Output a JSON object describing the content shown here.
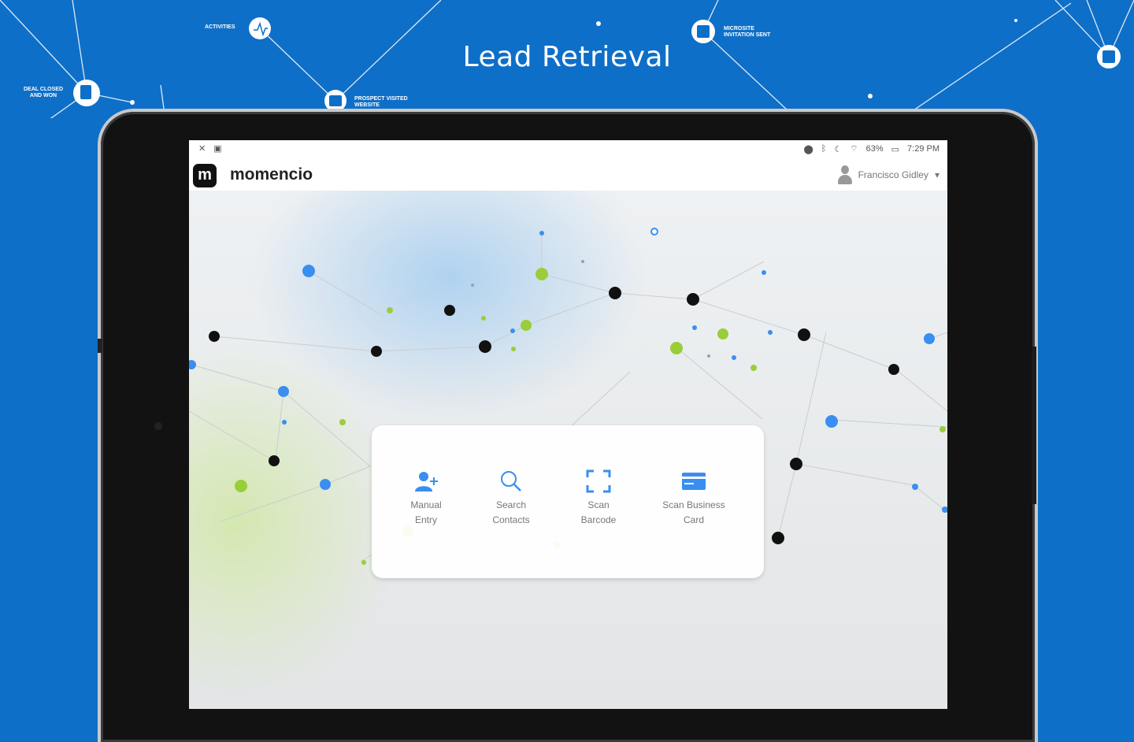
{
  "headline": "Lead Retrieval",
  "colors": {
    "background": "#0e6fc8",
    "accent_blue": "#3a8ef0",
    "accent_green": "#9acd3a",
    "node_dark": "#111111"
  },
  "background_nodes": [
    {
      "label": "ACTIVITIES",
      "icon": "activity-icon"
    },
    {
      "label": "DEAL CLOSED AND WON",
      "icon": "document-icon"
    },
    {
      "label": "PROSPECT VISITED WEBSITE",
      "icon": "web-icon"
    },
    {
      "label": "MICROSITE INVITATION SENT",
      "icon": "calendar-icon"
    },
    {
      "label": "",
      "icon": "calendar-icon"
    }
  ],
  "status_bar": {
    "left_icons": [
      "mute-icon",
      "image-icon"
    ],
    "battery": "63%",
    "time": "7:29 PM"
  },
  "app": {
    "logo_letter": "m",
    "name": "momencio",
    "user_name": "Francisco Gidley",
    "user_menu_caret": "▾"
  },
  "actions": [
    {
      "line1": "Manual",
      "line2": "Entry",
      "icon": "add-user-icon"
    },
    {
      "line1": "Search",
      "line2": "Contacts",
      "icon": "search-icon"
    },
    {
      "line1": "Scan",
      "line2": "Barcode",
      "icon": "scan-frame-icon"
    },
    {
      "line1": "Scan Business",
      "line2": "Card",
      "icon": "card-icon"
    }
  ]
}
